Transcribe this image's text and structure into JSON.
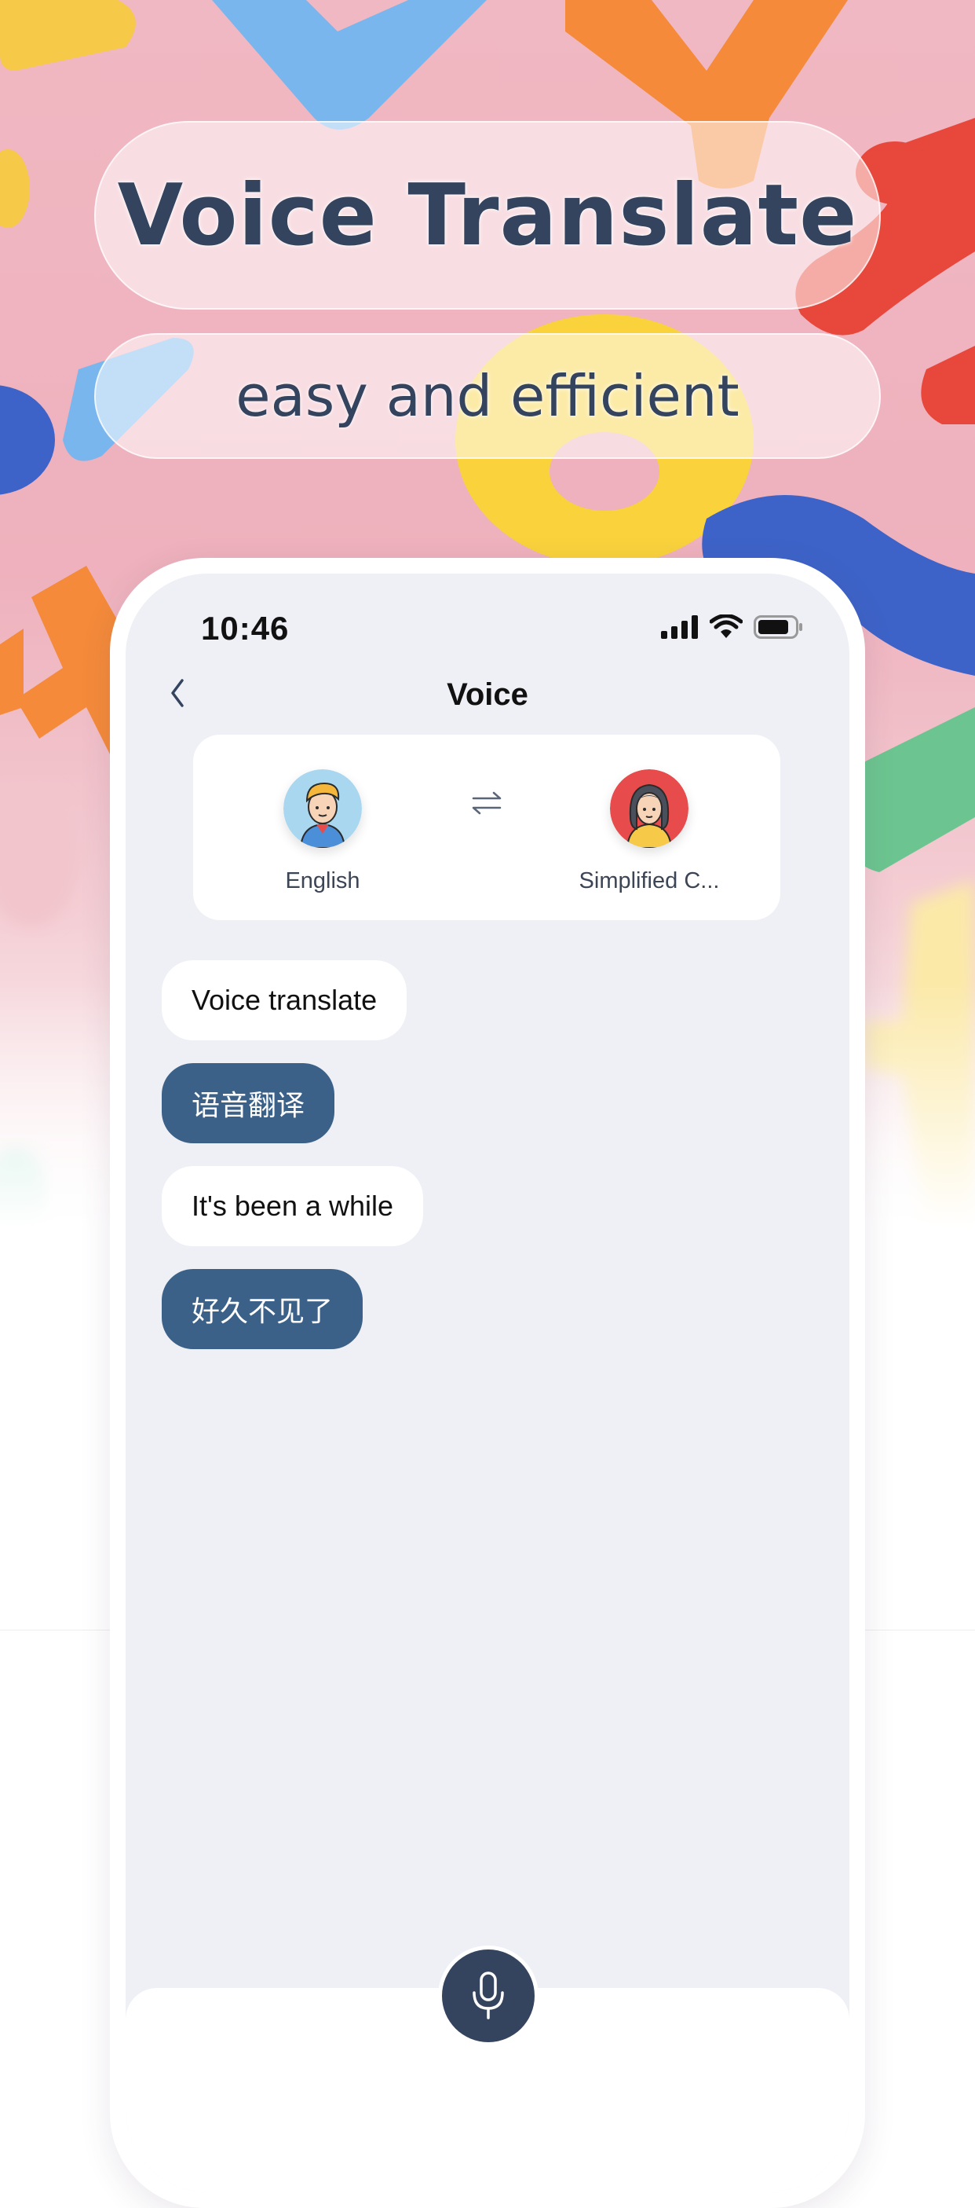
{
  "promo": {
    "title": "Voice Translate",
    "subtitle": "easy and efficient"
  },
  "status_bar": {
    "time": "10:46",
    "icons": [
      "cellular-signal-icon",
      "wifi-icon",
      "battery-icon"
    ]
  },
  "nav": {
    "back_icon": "chevron-left-icon",
    "title": "Voice"
  },
  "languages": {
    "source": {
      "label": "English",
      "avatar": "boy-avatar-icon"
    },
    "target": {
      "label": "Simplified C...",
      "avatar": "girl-avatar-icon"
    },
    "swap_icon": "swap-arrows-icon"
  },
  "messages": [
    {
      "type": "source",
      "text": "Voice translate"
    },
    {
      "type": "translation",
      "text": "语音翻译"
    },
    {
      "type": "source",
      "text": "It's been a while"
    },
    {
      "type": "translation",
      "text": "好久不见了"
    }
  ],
  "mic": {
    "icon": "microphone-icon"
  },
  "colors": {
    "accent_dark": "#35445e",
    "translation_bubble": "#3b6189",
    "screen_bg": "#eef0f5"
  }
}
